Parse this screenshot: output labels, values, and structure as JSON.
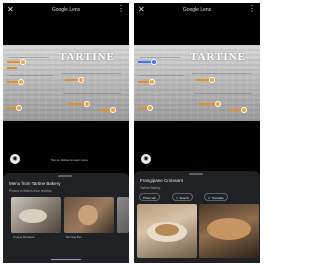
{
  "left_screen": {
    "title": "Google Lens",
    "close_icon": "close-icon",
    "menu_icon": "more-vert-icon",
    "photo_sign_text": "TARTINE",
    "hint_text": "Tap on dishes to learn more",
    "sheet": {
      "title": "Menu from Tartine Bakery",
      "subtitle": "Photos of dishes from reviews",
      "thumbnails": [
        {
          "caption": "Croque Monsieur"
        },
        {
          "caption": "Morning Bun"
        },
        {
          "caption": ""
        }
      ]
    }
  },
  "right_screen": {
    "title": "Google Lens",
    "close_icon": "close-icon",
    "menu_icon": "more-vert-icon",
    "photo_sign_text": "TARTINE",
    "sheet": {
      "title": "Frangipane Croissant",
      "subtitle": "Tartine Bakery",
      "chips": [
        {
          "icon": "image-icon",
          "label": "Photo tab"
        },
        {
          "icon": "search-icon",
          "label": "Search"
        },
        {
          "icon": "google-icon",
          "label": "Translate"
        }
      ],
      "photos": [
        {
          "caption": ""
        },
        {
          "caption": ""
        }
      ]
    }
  },
  "colors": {
    "background": "#000000",
    "sheet": "#202124",
    "highlight_orange": "#e58f2a",
    "highlight_blue": "#3d73ff"
  }
}
